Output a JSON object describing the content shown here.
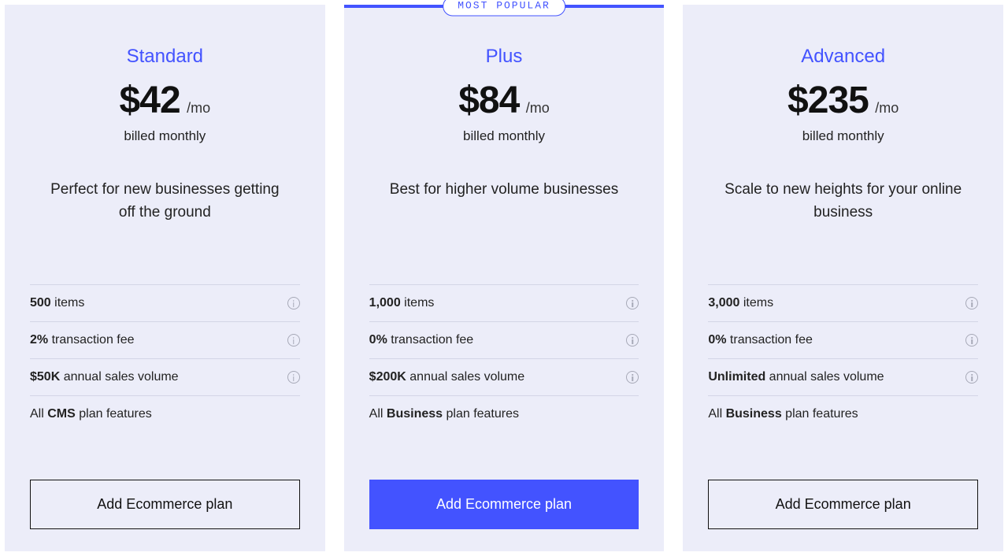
{
  "badge": "MOST POPULAR",
  "cta_label": "Add Ecommerce plan",
  "plans": [
    {
      "name": "Standard",
      "price": "$42",
      "per": "/mo",
      "billed": "billed monthly",
      "desc": "Perfect for new businesses getting off the ground",
      "f1_bold": "500",
      "f1_rest": " items",
      "f2_bold": "2%",
      "f2_rest": " transaction fee",
      "f3_bold": "$50K",
      "f3_rest": " annual sales volume",
      "inc_pre": "All ",
      "inc_bold": "CMS",
      "inc_post": " plan features"
    },
    {
      "name": "Plus",
      "price": "$84",
      "per": "/mo",
      "billed": "billed monthly",
      "desc": "Best for higher volume businesses",
      "f1_bold": "1,000",
      "f1_rest": " items",
      "f2_bold": "0%",
      "f2_rest": " transaction fee",
      "f3_bold": "$200K",
      "f3_rest": " annual sales volume",
      "inc_pre": "All ",
      "inc_bold": "Business",
      "inc_post": " plan features"
    },
    {
      "name": "Advanced",
      "price": "$235",
      "per": "/mo",
      "billed": "billed monthly",
      "desc": "Scale to new heights for your online business",
      "f1_bold": "3,000",
      "f1_rest": " items",
      "f2_bold": "0%",
      "f2_rest": " transaction fee",
      "f3_bold": "Unlimited",
      "f3_rest": " annual sales volume",
      "inc_pre": "All ",
      "inc_bold": "Business",
      "inc_post": " plan features"
    }
  ]
}
